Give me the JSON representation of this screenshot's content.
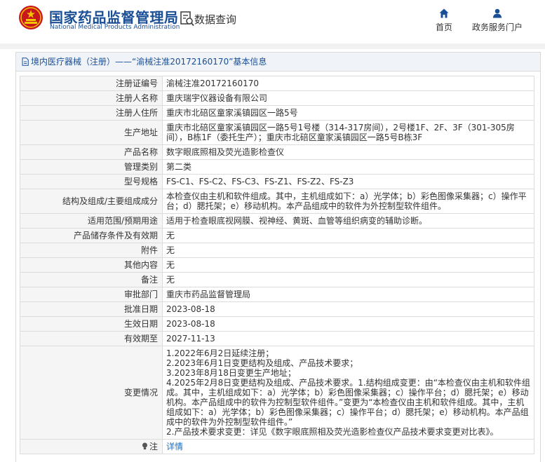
{
  "header": {
    "site_name_cn": "国家药品监督管理局",
    "site_name_en": "National Medical Products Administration",
    "data_query": "数据查询",
    "nav_home": "首页",
    "nav_portal": "政务服务门户"
  },
  "colors": {
    "brand_blue": "#1a4f96",
    "emblem_red": "#c8161d",
    "link_blue": "#1a6fc4"
  },
  "panel": {
    "title": "境内医疗器械（注册）——“渝械注准20172160170”基本信息"
  },
  "rows": [
    {
      "label": "注册证编号",
      "value": "渝械注准20172160170"
    },
    {
      "label": "注册人名称",
      "value": "重庆瑞宇仪器设备有限公司"
    },
    {
      "label": "注册人住所",
      "value": "重庆市北碚区童家溪镇园区一路5号"
    },
    {
      "label": "生产地址",
      "value": "重庆市北碚区童家溪镇园区一路5号1号楼（314-317房间），2号楼1F、2F、3F（301-305房间），B栋1F（委托生产）；重庆市北碚区童家溪镇园区一路5号B栋3F"
    },
    {
      "label": "产品名称",
      "value": "数字眼底照相及荧光造影检查仪"
    },
    {
      "label": "管理类别",
      "value": "第二类"
    },
    {
      "label": "型号规格",
      "value": "FS-C1、FS-C2、FS-C3、FS-Z1、FS-Z2、FS-Z3"
    },
    {
      "label": "结构及组成/主要组成成分",
      "value": "本检查仪由主机和软件组成。其中，主机组成如下：a）光学体；b）彩色图像采集器；c）操作平台；d）腮托架；e）移动机构。本产品组成中的软件为外控制型软件组件。"
    },
    {
      "label": "适用范围/预期用途",
      "value": "适用于检查眼底视网膜、视神经、黄斑、血管等组织病变的辅助诊断。"
    },
    {
      "label": "产品储存条件及有效期",
      "value": "无"
    },
    {
      "label": "附件",
      "value": "无"
    },
    {
      "label": "其他内容",
      "value": "无"
    },
    {
      "label": "备注",
      "value": "无"
    },
    {
      "label": "审批部门",
      "value": "重庆市药品监督管理局"
    },
    {
      "label": "批准日期",
      "value": "2023-08-18"
    },
    {
      "label": "生效日期",
      "value": "2023-08-18"
    },
    {
      "label": "有效期至",
      "value": "2027-11-13"
    }
  ],
  "change": {
    "label": "变更情况",
    "lines": [
      "1.2022年6月2日延续注册；",
      "2.2023年6月1日变更结构及组成、产品技术要求；",
      "3.2023年8月18日变更生产地址；",
      "4.2025年2月8日变更结构及组成、产品技术要求。1.结构组成变更：由“本检查仪由主机和软件组成。其中，主机组成如下：a）光学体；b）彩色图像采集器；c）操作平台；d）腮托架；e）移动机构。本产品组成中的软件为控制型软件组件。”变更为“本检查仪由主机和软件组成。其中，主机组成如下：a）光学体；b）彩色图像采集器；c）操作平台；d）腮托架；e）移动机构。本产品组成中的软件为外控制型软件组件。”",
      "2.产品技术要求变更：详见《数字眼底照相及荧光造影检查仪产品技术要求变更对比表》。"
    ]
  },
  "note": {
    "label": "注",
    "link": "详情"
  }
}
